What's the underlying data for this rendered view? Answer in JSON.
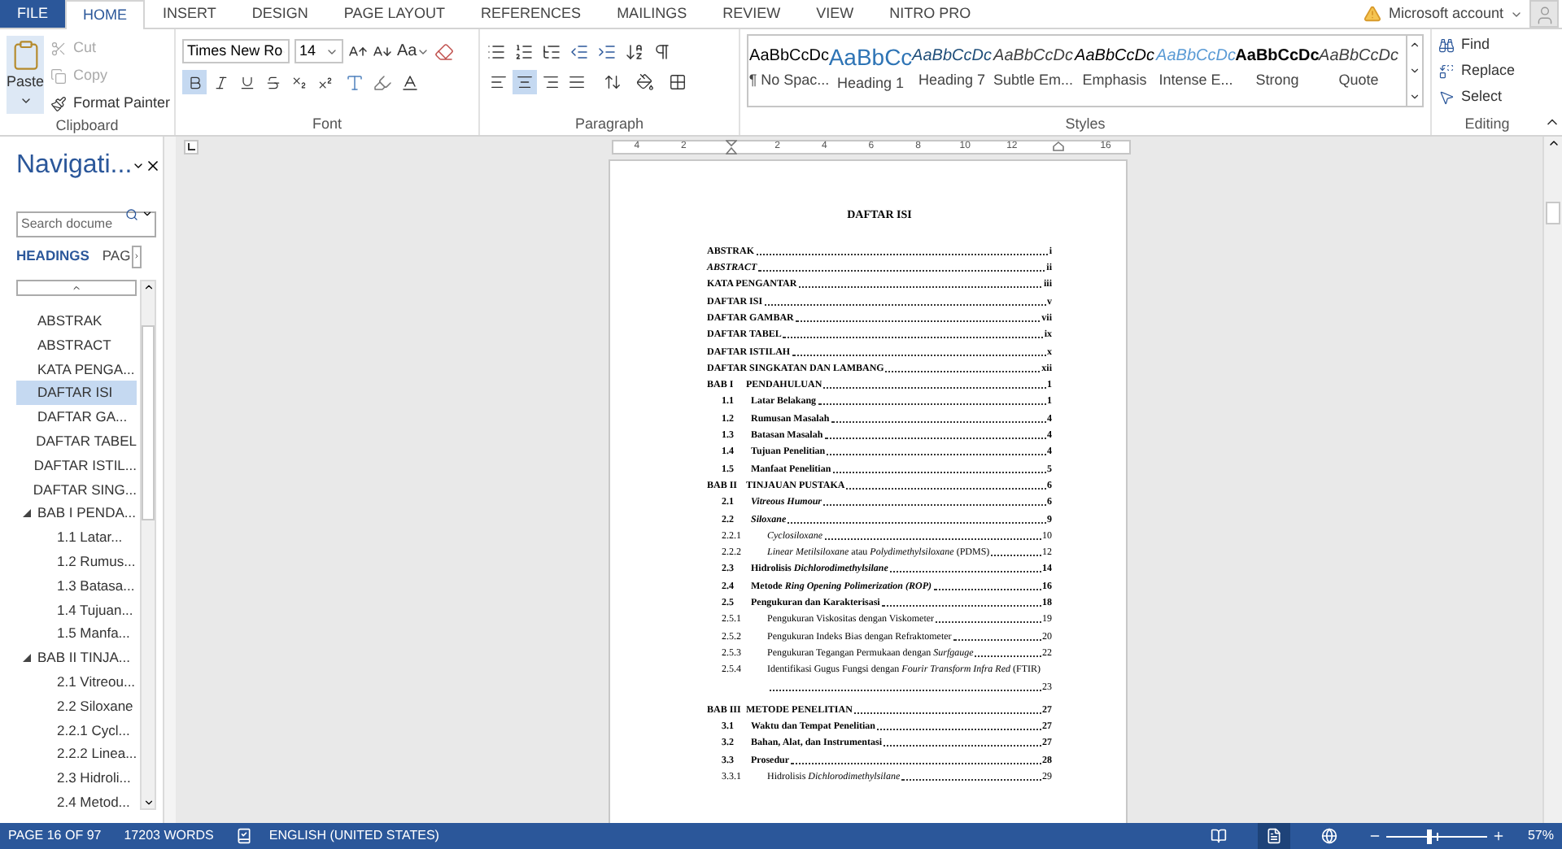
{
  "tabs": [
    {
      "label": "FILE",
      "kind": "file",
      "selected": false
    },
    {
      "label": "HOME",
      "kind": "tab",
      "selected": true
    },
    {
      "label": "INSERT",
      "kind": "tab",
      "selected": false
    },
    {
      "label": "DESIGN",
      "kind": "tab",
      "selected": false
    },
    {
      "label": "PAGE LAYOUT",
      "kind": "tab",
      "selected": false
    },
    {
      "label": "REFERENCES",
      "kind": "tab",
      "selected": false
    },
    {
      "label": "MAILINGS",
      "kind": "tab",
      "selected": false
    },
    {
      "label": "REVIEW",
      "kind": "tab",
      "selected": false
    },
    {
      "label": "VIEW",
      "kind": "tab",
      "selected": false
    },
    {
      "label": "NITRO PRO",
      "kind": "tab",
      "selected": false
    }
  ],
  "account": {
    "label": "Microsoft account"
  },
  "clipboard": {
    "label": "Clipboard",
    "paste": "Paste",
    "items": [
      {
        "label": "Cut",
        "kind": "cut",
        "disabled": true
      },
      {
        "label": "Copy",
        "kind": "copy",
        "disabled": true
      },
      {
        "label": "Format Painter",
        "kind": "painter",
        "disabled": false
      }
    ]
  },
  "font": {
    "label": "Font",
    "family": "Times New Ro",
    "size": "14",
    "change_case": "Aa",
    "format": [
      {
        "kind": "bold",
        "selected": true
      },
      {
        "kind": "italic",
        "selected": false
      },
      {
        "kind": "underline",
        "selected": false
      },
      {
        "kind": "strikethrough",
        "selected": false
      },
      {
        "kind": "subscript",
        "selected": false
      },
      {
        "kind": "superscript",
        "selected": false
      }
    ]
  },
  "paragraph": {
    "label": "Paragraph",
    "align": [
      {
        "kind": "left",
        "selected": false
      },
      {
        "kind": "center",
        "selected": true
      },
      {
        "kind": "right",
        "selected": false
      },
      {
        "kind": "justify",
        "selected": false
      }
    ]
  },
  "styles": {
    "label": "Styles",
    "items": [
      {
        "preview": "AaBbCcDc",
        "label": "¶ No Spac...",
        "kind": "normal",
        "selected": false
      },
      {
        "preview": "AaBbCc",
        "label": "Heading 1",
        "kind": "heading1",
        "selected": false
      },
      {
        "preview": "AaBbCcDc",
        "label": "Heading 7",
        "kind": "heading7",
        "selected": false
      },
      {
        "preview": "AaBbCcDc",
        "label": "Subtle Em...",
        "kind": "subtle",
        "selected": false
      },
      {
        "preview": "AaBbCcDc",
        "label": "Emphasis",
        "kind": "emphasis",
        "selected": false
      },
      {
        "preview": "AaBbCcDc",
        "label": "Intense E...",
        "kind": "intense",
        "selected": false
      },
      {
        "preview": "AaBbCcDc",
        "label": "Strong",
        "kind": "strong",
        "selected": false
      },
      {
        "preview": "AaBbCcDc",
        "label": "Quote",
        "kind": "quote",
        "selected": false
      }
    ]
  },
  "editing": {
    "label": "Editing",
    "items": [
      {
        "label": "Find",
        "kind": "find"
      },
      {
        "label": "Replace",
        "kind": "replace"
      },
      {
        "label": "Select",
        "kind": "select"
      }
    ]
  },
  "navigation": {
    "title": "Navigati...",
    "search_placeholder": "Search docume",
    "tabs": [
      {
        "label": "HEADINGS",
        "selected": true
      },
      {
        "label": "PAG",
        "selected": false
      }
    ],
    "headings": [
      {
        "label": "ABSTRAK",
        "selected": false
      },
      {
        "label": "ABSTRACT",
        "selected": false
      },
      {
        "label": "KATA PENGA...",
        "selected": false
      },
      {
        "label": "DAFTAR ISI",
        "selected": true
      },
      {
        "label": "DAFTAR GA...",
        "selected": false
      },
      {
        "label": "DAFTAR TABEL",
        "selected": false
      },
      {
        "label": "DAFTAR ISTIL...",
        "selected": false
      },
      {
        "label": "DAFTAR SING...",
        "selected": false
      },
      {
        "label": "BAB I PENDA...",
        "selected": false,
        "expanded": true,
        "children": [
          {
            "label": "1.1  Latar...",
            "selected": false
          },
          {
            "label": "1.2 Rumus...",
            "selected": false
          },
          {
            "label": "1.3 Batasa...",
            "selected": false
          },
          {
            "label": "1.4 Tujuan...",
            "selected": false
          },
          {
            "label": "1.5 Manfa...",
            "selected": false
          }
        ]
      },
      {
        "label": "BAB II TINJA...",
        "selected": false,
        "expanded": true,
        "children": [
          {
            "label": "2.1 Vitreou...",
            "selected": false
          },
          {
            "label": "2.2 Siloxane",
            "selected": false
          },
          {
            "label": "2.2.1 Cycl...",
            "selected": false
          },
          {
            "label": "2.2.2 Linea...",
            "selected": false
          },
          {
            "label": "2.3 Hidroli...",
            "selected": false
          },
          {
            "label": "2.4 Metod...",
            "selected": false
          }
        ]
      }
    ]
  },
  "ruler": {
    "numbers": [
      "4",
      "2",
      "2",
      "4",
      "6",
      "8",
      "10",
      "12",
      "16"
    ]
  },
  "document": {
    "title": "DAFTAR ISI",
    "entries": [
      {
        "kind": "top",
        "title": "ABSTRAK",
        "page": "i"
      },
      {
        "kind": "top",
        "title": "ABSTRACT",
        "italic": true,
        "page": "ii"
      },
      {
        "kind": "top",
        "title": "KATA PENGANTAR",
        "page": "iii"
      },
      {
        "kind": "top",
        "title": "DAFTAR ISI",
        "page": "v"
      },
      {
        "kind": "top",
        "title": "DAFTAR GAMBAR",
        "page": "vii"
      },
      {
        "kind": "top",
        "title": "DAFTAR TABEL",
        "page": "ix"
      },
      {
        "kind": "top",
        "title": "DAFTAR ISTILAH",
        "page": "x"
      },
      {
        "kind": "top",
        "title": "DAFTAR SINGKATAN DAN LAMBANG",
        "page": "xii"
      },
      {
        "kind": "chapter",
        "number": "BAB I",
        "title": "PENDAHULUAN",
        "page": "1"
      },
      {
        "kind": "section",
        "number": "1.1",
        "title": "Latar Belakang",
        "page": "1"
      },
      {
        "kind": "section",
        "number": "1.2",
        "title": "Rumusan Masalah",
        "page": "4"
      },
      {
        "kind": "section",
        "number": "1.3",
        "title": "Batasan Masalah",
        "page": "4"
      },
      {
        "kind": "section",
        "number": "1.4",
        "title": "Tujuan Penelitian",
        "page": "4"
      },
      {
        "kind": "section",
        "number": "1.5",
        "title": "Manfaat Penelitian",
        "page": "5"
      },
      {
        "kind": "chapter",
        "number": "BAB II",
        "title": "TINJAUAN PUSTAKA",
        "page": "6"
      },
      {
        "kind": "section",
        "number": "2.1",
        "title": "*Vitreous Humour*",
        "page": "6"
      },
      {
        "kind": "section",
        "number": "2.2",
        "title": "*Siloxane*",
        "page": "9"
      },
      {
        "kind": "subsection",
        "number": "2.2.1",
        "title": "*Cyclosiloxane*",
        "page": "10"
      },
      {
        "kind": "subsection",
        "number": "2.2.2",
        "title": "*Linear Metilsiloxane* atau *Polydimethylsiloxane* (PDMS)",
        "page": "12"
      },
      {
        "kind": "section",
        "number": "2.3",
        "title": "Hidrolisis *Dichlorodimethylsilane*",
        "page": "14"
      },
      {
        "kind": "section",
        "number": "2.4",
        "title": "Metode *Ring Opening Polimerization (ROP)*",
        "page": "16"
      },
      {
        "kind": "section",
        "number": "2.5",
        "title": "Pengukuran dan Karakterisasi",
        "page": "18"
      },
      {
        "kind": "subsection",
        "number": "2.5.1",
        "title": "Pengukuran Viskositas dengan Viskometer",
        "page": "19"
      },
      {
        "kind": "subsection",
        "number": "2.5.2",
        "title": "Pengukuran Indeks Bias dengan Refraktometer",
        "page": "20"
      },
      {
        "kind": "subsection",
        "number": "2.5.3",
        "title": "Pengukuran Tegangan Permukaan dengan *Surfgauge*",
        "page": "22"
      },
      {
        "kind": "subsection",
        "number": "2.5.4",
        "title": "Identifikasi Gugus Fungsi dengan *Fourir Transform Infra Red* (FTIR)",
        "page": "23",
        "wrapped": true
      },
      {
        "kind": "chapter",
        "number": "BAB III",
        "title": "METODE PENELITIAN",
        "page": "27",
        "space_before": true
      },
      {
        "kind": "section",
        "number": "3.1",
        "title": "Waktu dan Tempat Penelitian",
        "page": "27"
      },
      {
        "kind": "section",
        "number": "3.2",
        "title": "Bahan, Alat, dan Instrumentasi",
        "page": "27"
      },
      {
        "kind": "section",
        "number": "3.3",
        "title": "Prosedur",
        "page": "28"
      },
      {
        "kind": "subsection",
        "number": "3.3.1",
        "title": "Hidrolisis *Dichlorodimethylsilane*",
        "page": "29"
      }
    ]
  },
  "status_bar": {
    "page": "PAGE 16 OF 97",
    "words": "17203 WORDS",
    "language": "ENGLISH (UNITED STATES)",
    "views": [
      {
        "kind": "read",
        "selected": false
      },
      {
        "kind": "print",
        "selected": true
      },
      {
        "kind": "web",
        "selected": false
      }
    ],
    "zoom": {
      "level": 0.42,
      "reading": "57%"
    }
  }
}
